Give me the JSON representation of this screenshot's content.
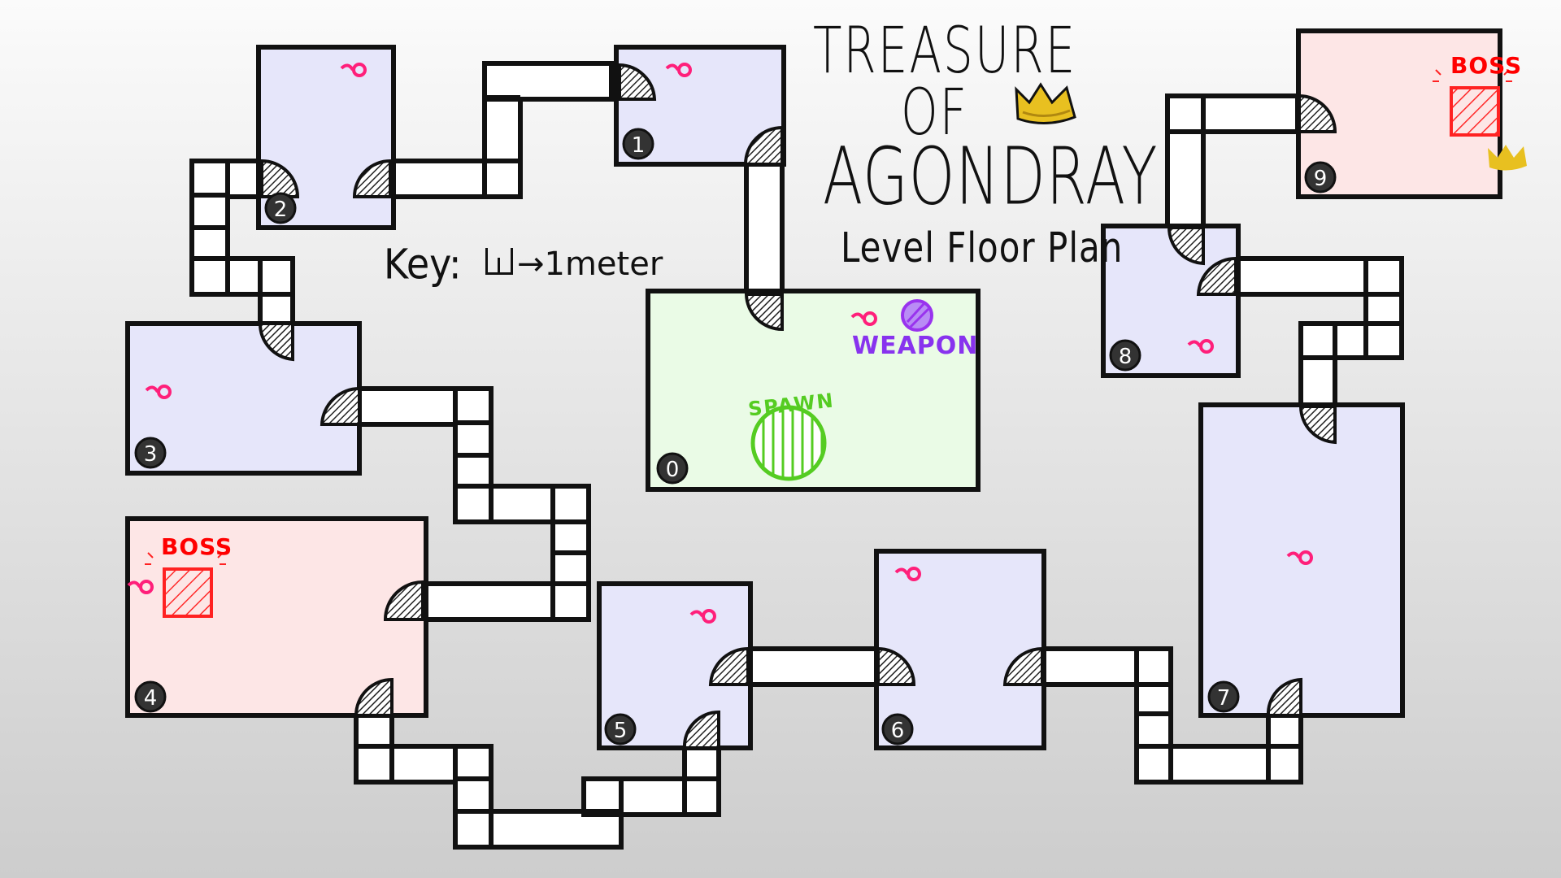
{
  "title": {
    "line1": "TREASURE",
    "line2": "OF",
    "line3": "AGONDRAY"
  },
  "subtitle": "Level Floor Plan",
  "key": {
    "label": "Key:",
    "value": "→1meter"
  },
  "rooms": [
    {
      "id": "0",
      "type": "spawn",
      "markers": [
        "enemy",
        "weapon",
        "spawn"
      ],
      "labels": {
        "weapon": "WEAPON",
        "spawn": "SPAWN"
      }
    },
    {
      "id": "1",
      "type": "normal",
      "markers": [
        "enemy"
      ]
    },
    {
      "id": "2",
      "type": "normal",
      "markers": [
        "enemy"
      ]
    },
    {
      "id": "3",
      "type": "normal",
      "markers": [
        "enemy"
      ]
    },
    {
      "id": "4",
      "type": "boss",
      "markers": [
        "enemy",
        "boss"
      ],
      "labels": {
        "boss": "BOSS"
      }
    },
    {
      "id": "5",
      "type": "normal",
      "markers": [
        "enemy"
      ]
    },
    {
      "id": "6",
      "type": "normal",
      "markers": [
        "enemy"
      ]
    },
    {
      "id": "7",
      "type": "normal",
      "markers": [
        "enemy"
      ]
    },
    {
      "id": "8",
      "type": "normal",
      "markers": [
        "enemy"
      ]
    },
    {
      "id": "9",
      "type": "boss",
      "markers": [
        "boss",
        "treasure-crown"
      ],
      "labels": {
        "boss": "BOSS"
      }
    }
  ],
  "colors": {
    "normal_room": "#e6e6fa",
    "boss_room": "#fde6e6",
    "spawn_room": "#eafbe6",
    "enemy_marker": "#ff1f7a",
    "boss_marker": "#ff2222",
    "weapon_marker": "#9933ee",
    "spawn_marker": "#55cc22",
    "crown": "#e8c020",
    "wall": "#111111",
    "corridor": "#ffffff"
  },
  "icons": {
    "enemy": "enemy-marker-icon",
    "boss": "boss-crate-icon",
    "weapon": "weapon-orb-icon",
    "spawn": "spawn-circle-icon",
    "crown": "crown-icon",
    "door": "door-swing-icon"
  }
}
